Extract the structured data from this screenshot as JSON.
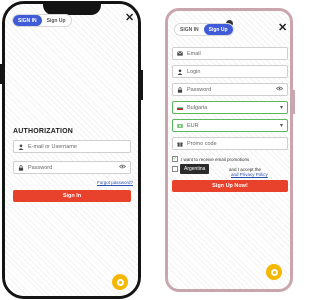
{
  "left_screen": {
    "tabs": [
      {
        "label": "SIGN IN",
        "active": true
      },
      {
        "label": "Sign Up",
        "active": false
      }
    ],
    "close_symbol": "✕",
    "heading": "AUTHORIZATION",
    "login_placeholder": "E-mail or Username",
    "password_placeholder": "Password",
    "forgot_link": "Forgot password?",
    "submit_label": "Sign In",
    "icons": [
      "user-icon",
      "lock-icon",
      "eye-toggle-icon",
      "chat-icon"
    ]
  },
  "right_screen": {
    "tabs": [
      {
        "label": "SIGN IN",
        "active": false
      },
      {
        "label": "Sign Up",
        "active": true
      }
    ],
    "close_symbol": "✕",
    "email_placeholder": "Email",
    "login_placeholder": "Login",
    "password_placeholder": "Password",
    "country_value": "Bulgaria",
    "currency_value": "EUR",
    "promo_placeholder": "Promo code",
    "promotions_label": "I want to receive email promotions",
    "terms_prefix": "and I accept the",
    "terms_link": "and Privacy Policy",
    "tooltip_text": "Argentina",
    "submit_label": "Sign Up Now!",
    "icons": [
      "mail-icon",
      "user-icon",
      "lock-icon",
      "eye-toggle-icon",
      "flag-icon",
      "currency-icon",
      "gift-icon",
      "chat-icon"
    ]
  },
  "colors": {
    "accent_blue": "#3f5bd8",
    "button_red": "#e8412c",
    "valid_green": "#5cb85c",
    "chat_yellow": "#f5b800"
  }
}
